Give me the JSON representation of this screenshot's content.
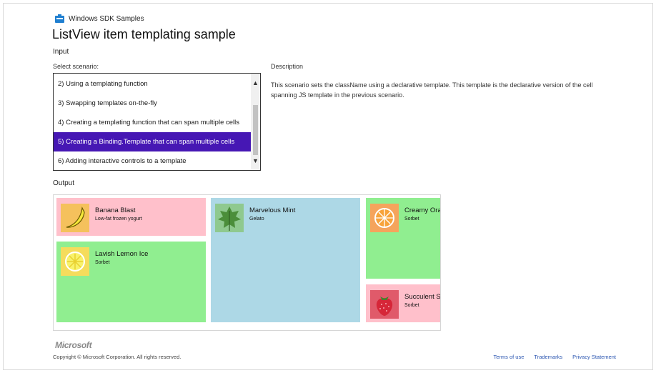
{
  "header": {
    "sdk_label": "Windows SDK Samples",
    "title": "ListView item templating sample"
  },
  "input": {
    "heading": "Input",
    "select_label": "Select scenario:",
    "scenarios": [
      {
        "label": "2) Using a templating function",
        "selected": false
      },
      {
        "label": "3) Swapping templates on-the-fly",
        "selected": false
      },
      {
        "label": "4) Creating a templating function that can span multiple cells",
        "selected": false
      },
      {
        "label": "5) Creating a Binding.Template that can span multiple cells",
        "selected": true
      },
      {
        "label": "6) Adding interactive controls to a template",
        "selected": false
      }
    ],
    "scroll_up": "▲",
    "scroll_down": "▼",
    "description_label": "Description",
    "description": "This scenario sets the className using a declarative template. This template is the declarative version of the cell spanning JS template in the previous scenario."
  },
  "output": {
    "heading": "Output",
    "tiles": [
      {
        "name": "Banana Blast",
        "type": "Low-fat frozen yogurt",
        "color": "#ffc0cb",
        "icon": "banana-icon"
      },
      {
        "name": "Lavish Lemon Ice",
        "type": "Sorbet",
        "color": "#90ee90",
        "icon": "lemon-icon"
      },
      {
        "name": "Marvelous Mint",
        "type": "Gelato",
        "color": "#add8e6",
        "icon": "mint-leaf-icon"
      },
      {
        "name": "Creamy Orange",
        "type": "Sorbet",
        "color": "#90ee90",
        "icon": "orange-icon"
      },
      {
        "name": "Succulent Strawberry",
        "type": "Sorbet",
        "color": "#ffc0cb",
        "icon": "strawberry-icon"
      }
    ]
  },
  "footer": {
    "logo": "Microsoft",
    "copyright": "Copyright © Microsoft Corporation. All rights reserved.",
    "links": [
      "Terms of use",
      "Trademarks",
      "Privacy Statement"
    ]
  }
}
